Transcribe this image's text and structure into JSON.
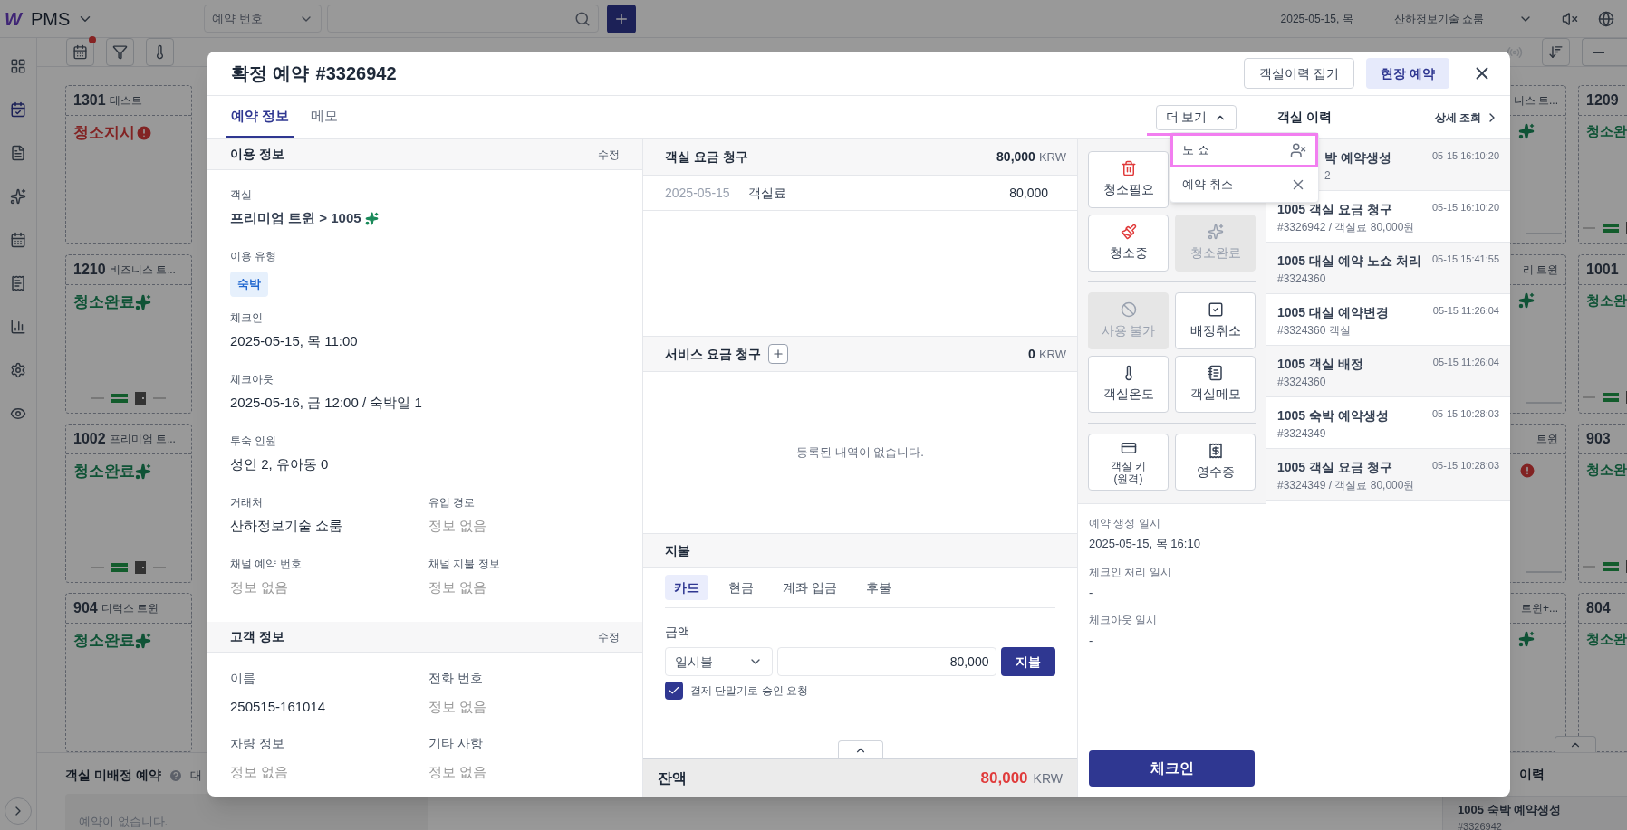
{
  "topbar": {
    "logo_mark": "W",
    "app_name": "PMS",
    "search_type": "예약 번호",
    "date": "2025-05-15, 목",
    "property": "산하정보기술 쇼룸"
  },
  "sidebar": [
    {
      "kind": "grid",
      "selected": false
    },
    {
      "kind": "booking",
      "selected": true
    },
    {
      "kind": "report",
      "selected": false
    },
    {
      "kind": "cleaning",
      "selected": false
    },
    {
      "kind": "calendar",
      "selected": false
    },
    {
      "kind": "receipt",
      "selected": false
    },
    {
      "kind": "chart",
      "selected": false
    },
    {
      "kind": "settings",
      "selected": false
    },
    {
      "kind": "view",
      "selected": false
    }
  ],
  "toolbar": {
    "alert_dot": true
  },
  "rooms_left": [
    {
      "number": "1301",
      "name": "테스트",
      "status": "청소지시",
      "kind": "alert",
      "keys": false
    },
    {
      "number": "1210",
      "name": "비즈니스 트...",
      "status": "청소완료",
      "kind": "clean",
      "keys": true
    },
    {
      "number": "1002",
      "name": "프리미엄 트...",
      "status": "청소완료",
      "kind": "clean",
      "keys": true
    },
    {
      "number": "904",
      "name": "디럭스 트윈",
      "status": "청소완료",
      "kind": "clean",
      "keys": false
    }
  ],
  "rooms_col_a": [
    {
      "name": "니스 트...",
      "kind": "clean",
      "keys": true
    },
    {
      "name": "리 트윈",
      "kind": "clean",
      "keys": true
    },
    {
      "name": "트윈",
      "kind": "alert",
      "keys": true
    },
    {
      "name": "트윈+...",
      "kind": "clean",
      "keys": false
    }
  ],
  "rooms_col_b": [
    {
      "number": "1209",
      "status": "청소완",
      "keys": true
    },
    {
      "number": "1001",
      "status": "청소완",
      "keys": true
    },
    {
      "number": "903",
      "status": "청소완",
      "keys": true
    },
    {
      "number": "804",
      "status": "청소완",
      "keys": false
    }
  ],
  "unassigned": {
    "title": "객실 미배정 예약",
    "tab": "대",
    "empty": "예약이 없습니다."
  },
  "history_bg": {
    "title": "이력",
    "item_title": "1005 숙박 예약생성",
    "item_sub": "#3326942"
  },
  "modal": {
    "title": "확정 예약",
    "number": "#3326942",
    "header_buttons": [
      {
        "label": "객실이력 접기",
        "selected": false
      },
      {
        "label": "현장 예약",
        "selected": true
      }
    ],
    "tabs": [
      {
        "label": "예약 정보",
        "selected": true
      },
      {
        "label": "메모",
        "selected": false
      }
    ],
    "more": {
      "label": "더 보기",
      "expanded": true,
      "highlighted": true
    },
    "menu": [
      {
        "label": "노 쇼",
        "kind": "no-show",
        "highlighted": true
      },
      {
        "label": "예약 취소",
        "kind": "cancel",
        "highlighted": false
      }
    ],
    "usage": {
      "title": "이용 정보",
      "edit": "수정",
      "rows": [
        [
          {
            "label": "객실",
            "value": "프리미엄 트윈 > 1005",
            "kind": "room"
          }
        ],
        [
          {
            "label": "이용 유형",
            "value": "숙박",
            "kind": "badge"
          }
        ],
        [
          {
            "label": "체크인",
            "value": "2025-05-15, 목 11:00",
            "kind": "text"
          }
        ],
        [
          {
            "label": "체크아웃",
            "value": "2025-05-16, 금 12:00 / 숙박일 1",
            "kind": "text"
          }
        ],
        [
          {
            "label": "투숙 인원",
            "value": "성인 2, 유아동 0",
            "kind": "text"
          }
        ],
        [
          {
            "label": "거래처",
            "value": "산하정보기술 쇼룸",
            "kind": "text"
          },
          {
            "label": "유입 경로",
            "value": "정보 없음",
            "kind": "empty"
          }
        ],
        [
          {
            "label": "채널 예약 번호",
            "value": "정보 없음",
            "kind": "empty"
          },
          {
            "label": "채널 지불 정보",
            "value": "정보 없음",
            "kind": "empty"
          }
        ]
      ]
    },
    "customer": {
      "title": "고객 정보",
      "edit": "수정",
      "rows": [
        [
          {
            "label": "이름",
            "value": "250515-161014",
            "kind": "text"
          },
          {
            "label": "전화 번호",
            "value": "정보 없음",
            "kind": "empty"
          }
        ],
        [
          {
            "label": "차량 정보",
            "value": "정보 없음",
            "kind": "empty"
          },
          {
            "label": "기타 사항",
            "value": "정보 없음",
            "kind": "empty"
          }
        ]
      ]
    },
    "charges": {
      "title": "객실 요금 청구",
      "total": "80,000",
      "currency": "KRW",
      "rows": [
        {
          "date": "2025-05-15",
          "item": "객실료",
          "amount": "80,000"
        }
      ]
    },
    "service": {
      "title": "서비스 요금 청구",
      "total": "0",
      "currency": "KRW",
      "empty": "등록된 내역이 없습니다."
    },
    "payment": {
      "title": "지불",
      "tabs": [
        {
          "label": "카드",
          "selected": true
        },
        {
          "label": "현금",
          "selected": false
        },
        {
          "label": "계좌 입금",
          "selected": false
        },
        {
          "label": "후불",
          "selected": false
        }
      ],
      "amount_label": "금액",
      "plan": "일시불",
      "amount": "80,000",
      "pay": "지불",
      "terminal": {
        "label": "결제 단말기로 승인 요청",
        "checked": true
      }
    },
    "balance": {
      "label": "잔액",
      "amount": "80,000",
      "currency": "KRW"
    },
    "action_groups": [
      [
        {
          "label": "청소필요",
          "kind": "trash",
          "disabled": false
        },
        {
          "label": "청소중",
          "kind": "broom",
          "disabled": false
        },
        {
          "label": "청소완료",
          "kind": "sparkle",
          "disabled": true
        }
      ],
      [
        {
          "label": "사용 불가",
          "kind": "ban",
          "disabled": true
        },
        {
          "label": "배정취소",
          "kind": "unassign",
          "disabled": false
        },
        {
          "label": "객실온도",
          "kind": "thermometer",
          "disabled": false
        },
        {
          "label": "객실메모",
          "kind": "memo",
          "disabled": false
        }
      ],
      [
        {
          "label": "객실 키 (원격)",
          "kind": "key",
          "disabled": false
        },
        {
          "label": "영수증",
          "kind": "receipt",
          "disabled": false
        }
      ]
    ],
    "timeline": [
      {
        "label": "예약 생성 일시",
        "value": "2025-05-15, 목 16:10"
      },
      {
        "label": "체크인 처리 일시",
        "value": "-"
      },
      {
        "label": "체크아웃 일시",
        "value": "-"
      }
    ],
    "checkin": "체크인",
    "history": {
      "title": "객실 이력",
      "detail": "상세 조회",
      "items": [
        {
          "title": "박 예약생성",
          "sub": "2",
          "time": "05-15 16:10:20",
          "kind": "partial"
        },
        {
          "title": "1005 객실 요금 청구",
          "sub": "#3326942 / 객실료 80,000원",
          "time": "05-15 16:10:20",
          "kind": "full"
        },
        {
          "title": "1005 대실 예약 노쇼 처리",
          "sub": "#3324360",
          "time": "05-15 15:41:55",
          "kind": "full"
        },
        {
          "title": "1005 대실 예약변경",
          "sub": "#3324360 객실",
          "time": "05-15 11:26:04",
          "kind": "full"
        },
        {
          "title": "1005 객실 배정",
          "sub": "#3324360",
          "time": "05-15 11:26:04",
          "kind": "full"
        },
        {
          "title": "1005 숙박 예약생성",
          "sub": "#3324349",
          "time": "05-15 10:28:03",
          "kind": "full"
        },
        {
          "title": "1005 객실 요금 청구",
          "sub": "#3324349 / 객실료 80,000원",
          "time": "05-15 10:28:03",
          "kind": "full"
        }
      ]
    }
  }
}
